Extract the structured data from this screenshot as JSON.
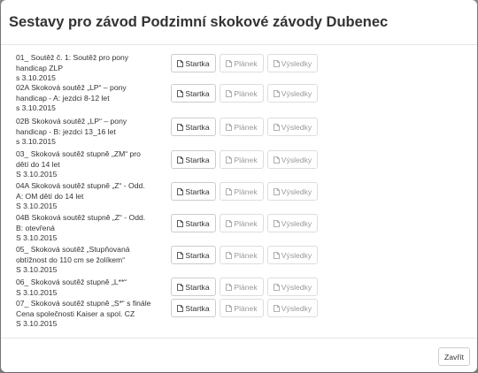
{
  "modal": {
    "title": "Sestavy pro závod Podzimní skokové závody Dubenec",
    "close_label": "Zavřít"
  },
  "icons": {
    "document": "file-pdf-icon"
  },
  "rows": [
    {
      "desc": "01_ Soutěž č. 1: Soutěž pro pony\nhandicap ZLP\ns 3.10.2015",
      "startka": "Startka",
      "planek": "Plánek",
      "vysledky": "Výsledky"
    },
    {
      "desc": "02A Skoková soutěž „LP“ – pony\nhandicap - A: jezdci 8-12 let\ns 3.10.2015",
      "startka": "Startka",
      "planek": "Plánek",
      "vysledky": "Výsledky"
    },
    {
      "desc": "02B Skoková soutěž „LP“ – pony\nhandicap - B: jezdci 13_16 let\ns 3.10.2015",
      "startka": "Startka",
      "planek": "Plánek",
      "vysledky": "Výsledky"
    },
    {
      "desc": "03_ Skoková soutěž stupně „ZM“ pro\ndětí do 14 let\nS 3.10.2015",
      "startka": "Startka",
      "planek": "Plánek",
      "vysledky": "Výsledky"
    },
    {
      "desc": "04A Skoková soutěž stupně „Z“ - Odd.\nA: OM dětí do 14 let\nS 3.10.2015",
      "startka": "Startka",
      "planek": "Plánek",
      "vysledky": "Výsledky"
    },
    {
      "desc": "04B Skoková soutěž stupně „Z“ - Odd.\nB: otevřená\nS 3.10.2015",
      "startka": "Startka",
      "planek": "Plánek",
      "vysledky": "Výsledky"
    },
    {
      "desc": "05_ Skoková soutěž „Stupňovaná\nobtížnost do 110 cm se žolíkem“\nS 3.10.2015",
      "startka": "Startka",
      "planek": "Plánek",
      "vysledky": "Výsledky"
    },
    {
      "desc": "06_ Skoková soutěž stupně „L**“\nS 3.10.2015",
      "startka": "Startka",
      "planek": "Plánek",
      "vysledky": "Výsledky"
    },
    {
      "desc": "07_ Skoková soutěž stupně „S*“ s finále\nCena společnosti Kaiser a spol. CZ\nS 3.10.2015",
      "startka": "Startka",
      "planek": "Plánek",
      "vysledky": "Výsledky"
    }
  ]
}
